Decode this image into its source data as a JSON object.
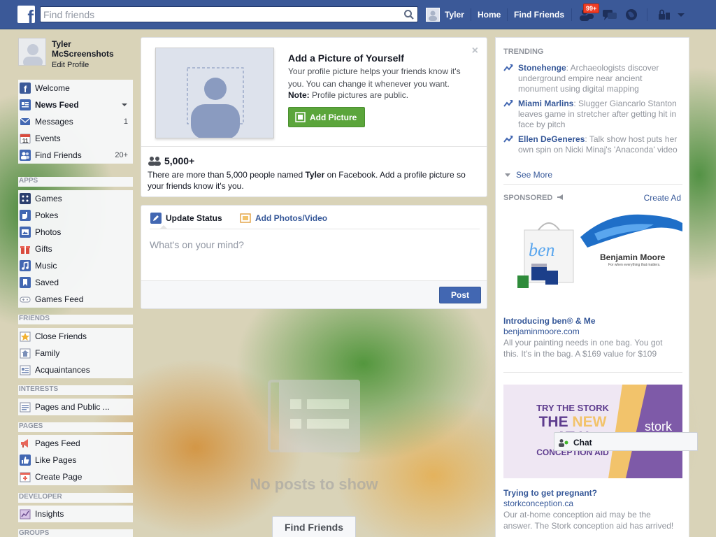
{
  "topbar": {
    "search_placeholder": "Find friends",
    "user_name": "Tyler",
    "home_label": "Home",
    "find_friends_label": "Find Friends",
    "notification_count": "99+"
  },
  "leftnav": {
    "profile_name": "Tyler McScreenshots",
    "edit_profile": "Edit Profile",
    "main_items": [
      {
        "label": "Welcome",
        "count": ""
      },
      {
        "label": "News Feed",
        "count": ""
      },
      {
        "label": "Messages",
        "count": "1"
      },
      {
        "label": "Events",
        "count": ""
      },
      {
        "label": "Find Friends",
        "count": "20+"
      }
    ],
    "apps_head": "APPS",
    "apps_items": [
      {
        "label": "Games"
      },
      {
        "label": "Pokes"
      },
      {
        "label": "Photos"
      },
      {
        "label": "Gifts"
      },
      {
        "label": "Music"
      },
      {
        "label": "Saved"
      },
      {
        "label": "Games Feed"
      }
    ],
    "friends_head": "FRIENDS",
    "friends_items": [
      {
        "label": "Close Friends"
      },
      {
        "label": "Family"
      },
      {
        "label": "Acquaintances"
      }
    ],
    "interests_head": "INTERESTS",
    "interests_items": [
      {
        "label": "Pages and Public ..."
      }
    ],
    "pages_head": "PAGES",
    "pages_items": [
      {
        "label": "Pages Feed"
      },
      {
        "label": "Like Pages"
      },
      {
        "label": "Create Page"
      }
    ],
    "developer_head": "DEVELOPER",
    "developer_items": [
      {
        "label": "Insights"
      }
    ],
    "groups_head": "GROUPS"
  },
  "add_picture": {
    "title": "Add a Picture of Yourself",
    "description": "Your profile picture helps your friends know it's you. You can change it whenever you want.",
    "note_label": "Note:",
    "note_text": " Profile pictures are public.",
    "button_label": "Add Picture",
    "close": "×",
    "people_count": "5,000+",
    "people_desc_1": "There are more than 5,000 people named ",
    "people_desc_name": "Tyler",
    "people_desc_2": " on Facebook. Add a profile picture so your friends know it's you."
  },
  "composer": {
    "tab_status": "Update Status",
    "tab_photos": "Add Photos/Video",
    "placeholder": "What's on your mind?",
    "post_label": "Post"
  },
  "feed": {
    "empty_text": "No posts to show",
    "find_friends_label": "Find Friends"
  },
  "trending": {
    "head": "TRENDING",
    "items": [
      {
        "topic": "Stonehenge",
        "text": ": Archaeologists discover underground empire near ancient monument using digital mapping"
      },
      {
        "topic": "Miami Marlins",
        "text": ": Slugger Giancarlo Stanton leaves game in stretcher after getting hit in face by pitch"
      },
      {
        "topic": "Ellen DeGeneres",
        "text": ": Talk show host puts her own spin on Nicki Minaj's 'Anaconda' video"
      }
    ],
    "see_more": "See More"
  },
  "sponsored": {
    "head": "SPONSORED",
    "create_ad": "Create Ad",
    "ads": [
      {
        "brand": "Benjamin Moore",
        "brand_tag": "For when everything that matters.",
        "bag_text": "ben",
        "title": "Introducing ben® & Me",
        "url": "benjaminmoore.com",
        "desc": "All your painting needs in one bag. You got this. It's in the bag. A $169 value for $109"
      },
      {
        "line1": "TRY THE STORK",
        "line2a": "THE ",
        "line2b": "NEW",
        "line3": "AT-H",
        "line4": "CONCEPTION AID",
        "logo": "stork",
        "title": "Trying to get pregnant?",
        "url": "storkconception.ca",
        "desc": "Our at-home conception aid may be the answer. The Stork conception aid has arrived!"
      }
    ]
  },
  "chat": {
    "label": "Chat"
  },
  "colors": {
    "brand_blue": "#3b5998",
    "link_blue": "#365899",
    "green_button": "#5ba53b",
    "badge_red": "#f03d25"
  }
}
